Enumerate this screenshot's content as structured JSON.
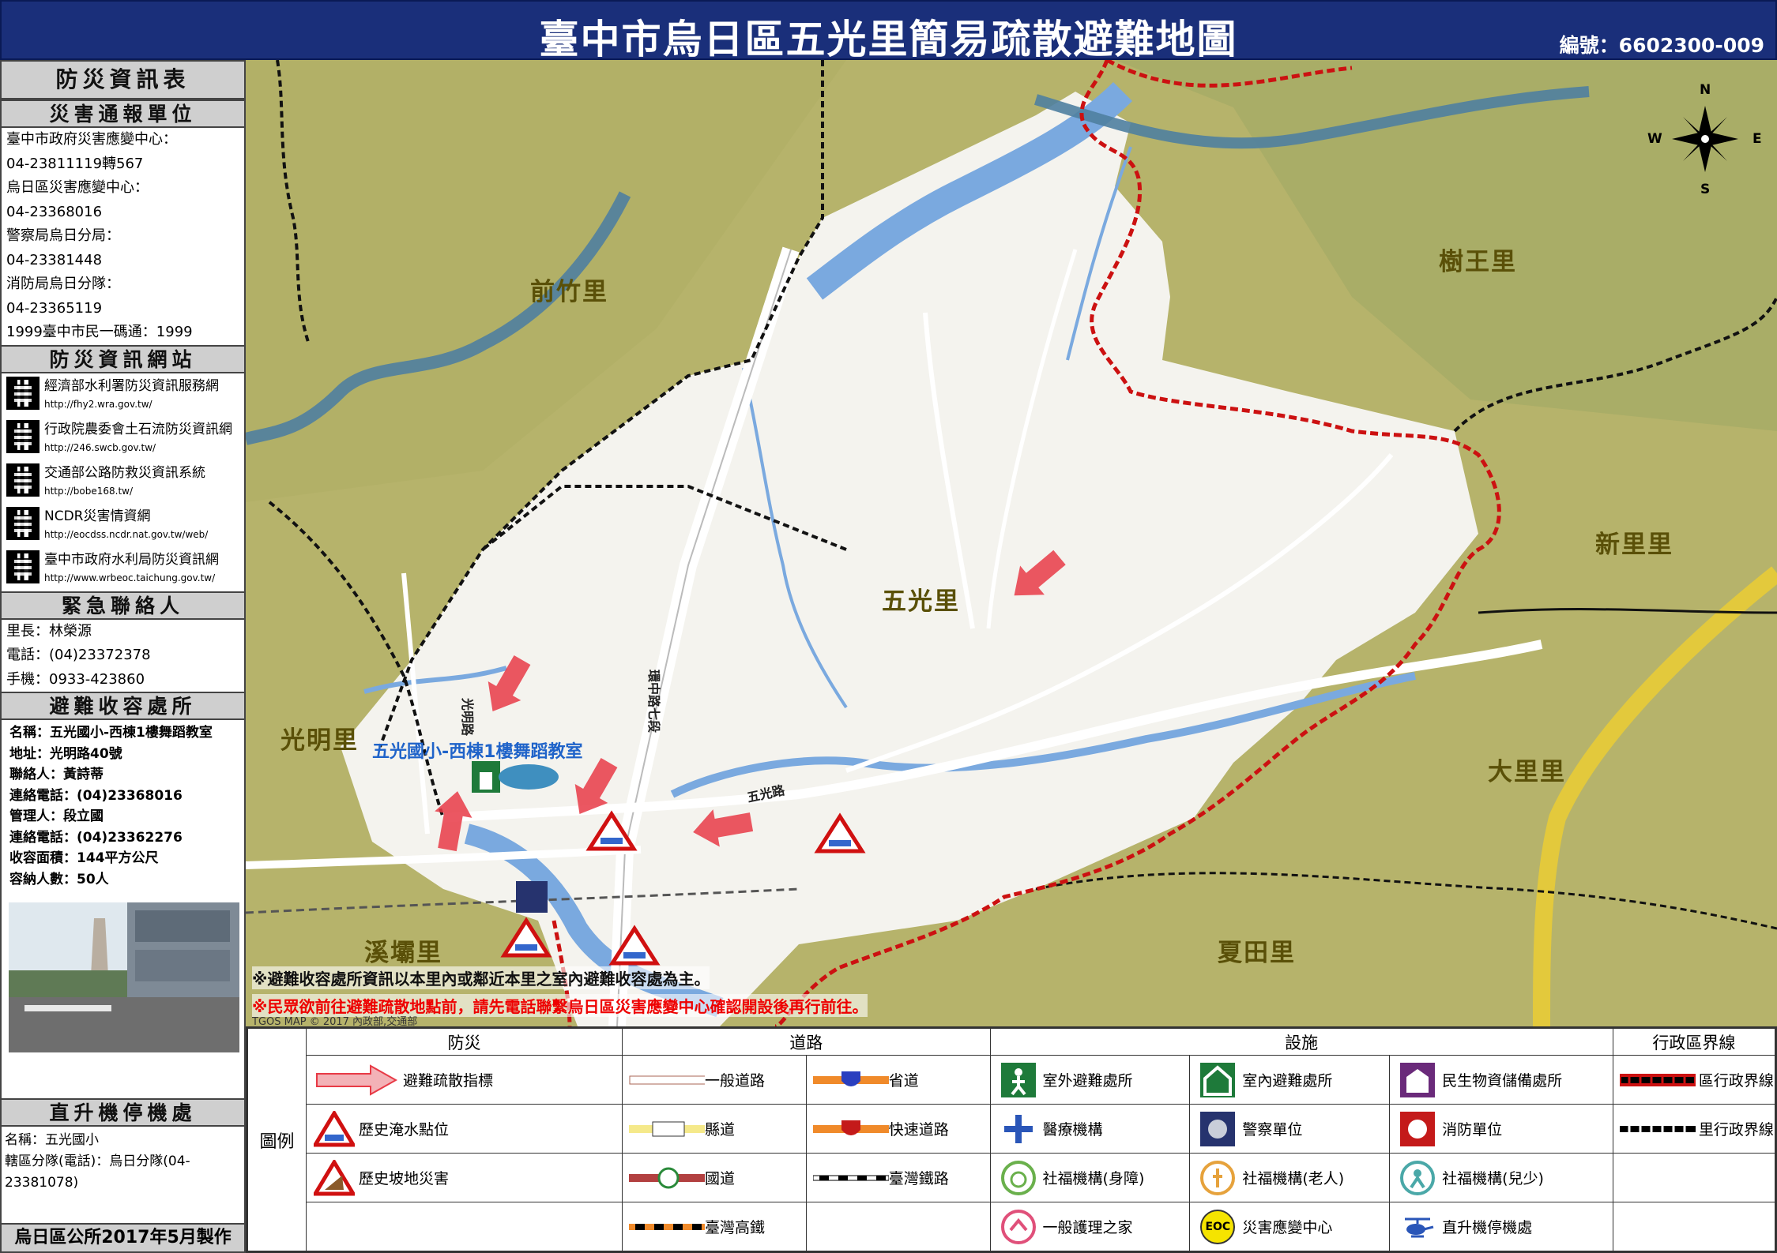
{
  "header": {
    "title": "臺中市烏日區五光里簡易疏散避難地圖",
    "serial": "編號：6602300-009"
  },
  "info_panel": {
    "title": "防災資訊表",
    "reporting": {
      "heading": "災害通報單位",
      "lines": [
        "臺中市政府災害應變中心：",
        "04-23811119轉567",
        "烏日區災害應變中心：",
        "04-23368016",
        "警察局烏日分局：",
        "04-23381448",
        "消防局烏日分隊：",
        "04-23365119",
        "1999臺中市民一碼通：1999"
      ]
    },
    "websites": {
      "heading": "防災資訊網站",
      "items": [
        {
          "name": "經濟部水利署防災資訊服務網",
          "url": "http://fhy2.wra.gov.tw/"
        },
        {
          "name": "行政院農委會土石流防災資訊網",
          "url": "http://246.swcb.gov.tw/"
        },
        {
          "name": "交通部公路防救災資訊系統",
          "url": "http://bobe168.tw/"
        },
        {
          "name": "NCDR災害情資網",
          "url": "http://eocdss.ncdr.nat.gov.tw/web/"
        },
        {
          "name": "臺中市政府水利局防災資訊網",
          "url": "http://www.wrbeoc.taichung.gov.tw/"
        }
      ]
    },
    "contact": {
      "heading": "緊急聯絡人",
      "lines": [
        "里長：林榮源",
        "電話：(04)23372378",
        "手機：0933-423860"
      ]
    },
    "shelter": {
      "heading": "避難收容處所",
      "lines": [
        "名稱：五光國小-西棟1樓舞蹈教室",
        "地址：光明路40號",
        "聯絡人：黃詩蒂",
        "連絡電話：(04)23368016",
        "管理人：段立國",
        "連絡電話：(04)23362276",
        "收容面積：144平方公尺",
        "容納人數：50人"
      ]
    },
    "helipad": {
      "heading": "直升機停機處",
      "lines": [
        "名稱：五光國小",
        "轄區分隊(電話)：烏日分隊(04-23381078)"
      ]
    },
    "made_by": "烏日區公所2017年5月製作"
  },
  "map": {
    "village_labels": [
      {
        "id": "qianzhu",
        "text": "前竹里"
      },
      {
        "id": "shuwang",
        "text": "樹王里"
      },
      {
        "id": "xinli",
        "text": "新里里"
      },
      {
        "id": "wuguang",
        "text": "五光里"
      },
      {
        "id": "guangming",
        "text": "光明里"
      },
      {
        "id": "dali",
        "text": "大里里"
      },
      {
        "id": "xiba",
        "text": "溪壩里"
      },
      {
        "id": "xiatian",
        "text": "夏田里"
      }
    ],
    "shelter_label": "五光國小-西棟1樓舞蹈教室",
    "road_labels": {
      "wuguang_road": "五光路",
      "guangming_road": "光明路",
      "ring_road": "環中路七段"
    },
    "compass": {
      "n": "N",
      "s": "S",
      "e": "E",
      "w": "W"
    },
    "note_shelter": "※避難收容處所資訊以本里內或鄰近本里之室內避難收容處為主。",
    "note_call": "※民眾欲前往避難疏散地點前，請先電話聯繫烏日區災害應變中心確認開設後再行前往。",
    "copyright": "TGOS MAP © 2017 內政部,交通部",
    "colors": {
      "district_boundary": "#cc1111",
      "village_boundary": "#111111",
      "river": "#4a7fc0",
      "arrow": "#e83a46"
    }
  },
  "legend": {
    "title": "圖例",
    "columns": {
      "disaster": "防災",
      "road": "道路",
      "facility": "設施",
      "boundary": "行政區界線"
    },
    "disaster": [
      "避難疏散指標",
      "歷史淹水點位",
      "歷史坡地災害"
    ],
    "road": [
      "一般道路",
      "省道",
      "縣道",
      "快速道路",
      "國道",
      "臺灣鐵路",
      "臺灣高鐵"
    ],
    "facility": [
      "室外避難處所",
      "室內避難處所",
      "民生物資儲備處所",
      "醫療機構",
      "警察單位",
      "消防單位",
      "社福機構(身障)",
      "社福機構(老人)",
      "社福機構(兒少)",
      "一般護理之家",
      "災害應變中心",
      "直升機停機處"
    ],
    "boundary": [
      "區行政界線",
      "里行政界線"
    ],
    "eoc_badge": "EOC"
  }
}
